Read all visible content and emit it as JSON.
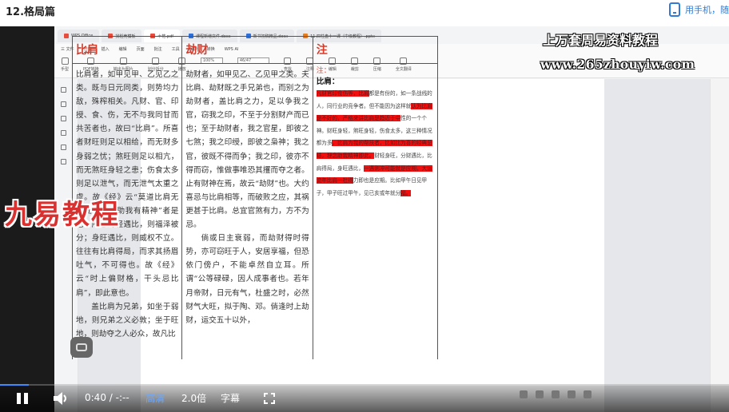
{
  "header": {
    "title": "12.格局篇",
    "phone_link": "用手机，随"
  },
  "wps": {
    "tabs": [
      {
        "label": "WPS Office",
        "color": "#e74c3c"
      },
      {
        "label": "找稻壳模板",
        "color": "#e74c3c"
      },
      {
        "label": "十格.pdf",
        "color": "#e74c3c"
      },
      {
        "label": "课程新增文件.docx",
        "color": "#2f6fd6"
      },
      {
        "label": "新书初稿精品.docx",
        "color": "#2f6fd6"
      },
      {
        "label": "11.四柱盘十一课（中级教程）.pptx",
        "color": "#e67e22"
      }
    ],
    "menu": [
      "三 文件",
      "开始",
      "插入",
      "编辑",
      "页面",
      "批注",
      "工具",
      "保护",
      "转换",
      "WPS AI"
    ],
    "menu_active": "开始",
    "toolbar": [
      "手型",
      "选择",
      "PDF转换",
      "输出为图片",
      "划分拆分",
      "播放",
      "100%",
      "旋转文件",
      "单页",
      "双页",
      "连续阅读",
      "查找",
      "注释",
      "编辑",
      "裁剪",
      "压缩",
      "全文翻译"
    ],
    "zoom": "100%",
    "page_indicator": "46/47"
  },
  "document": {
    "columns": [
      {
        "heading": "比肩",
        "paragraphs": [
          "比肩者，如甲见甲、乙见乙之类。既与日元同类，则势均力敌，殊榨相关。凡财、官、印授、食、伤，无不与我同甘而共苦者也，故曰“比肩”。所喜者财旺则足以相给，而无财多身弱之忧；煞旺则足以相亢，而无煞旺身轻之患；伤食太多则足以泄气，而无泄气太重之虞。故《经》云“莫道比肩无用处，比肩助我有精神”者是也。所忌财轻遇比，则福泽被分；身旺遇比，则威权不立。往往有比肩得局，而求其扬眉吐气，不可得也。故《经》云“时上偏财格，干头忌比肩”，即此意也。",
          "盖比肩为兄弟，如坐于弱地，则兄弟之义必敦；坐于旺地，则劫夺之人必众，故凡比"
        ]
      },
      {
        "heading": "劫财",
        "paragraphs": [
          "劫财者，如甲见乙、乙见甲之类。夫比肩、劫财既之手兄弟也，而别之为劫财者，盖比肩之力，足以争我之官，窃我之印，不至于分割财产而已也；至于劫财者，我之官星，即彼之七煞；我之印绶，即彼之枭神；我之官，彼既不得而争；我之印，彼亦不得而窃，惟做事唯恐其攫而夺之者。止有财神在焉，故云“劫财”也。大约喜忌与比肩相等，而破败之应，其祸更甚于比肩。总宜官煞有力，方不为忌。",
          "倘或日主衰弱，而劫财得时得势，亦可窃旺于人，安居享福，但恐依门傍户，不能卓然自立耳。所谓“公等碌碌，因人成事者也。若年月帝财，日元有气，杜盛之时，必然财气大旺，拟于陶、邓。倘逢时上劫财，运交五十以外，"
        ]
      },
      {
        "heading": "注",
        "note_mark": "注：",
        "note_title": "比肩：",
        "note_text": "凡财官印食伤等，比肩都是有份的，如一条战线的人，同行业的竞争者。但不能因为这样就认为比肩是不好的，严格来讲比肩是趋近于中性的一个个神。财旺身轻，煞旺身轻，伤食太多，这三种情况都为多，比肩为我的帮扶者，比如比为喜的经典总结，理念助我精神即此。财轻身旺，分财遇比，比肩得局，身旺遇比，一遇则冲可能就是应期，大运流年比肩一杜得力即也是应期。比如甲午日见甲子，甲子旺过甲午，见已亥或年就分福。"
      }
    ]
  },
  "watermarks": {
    "top_line1": "上万套周易资料教程",
    "top_line2": "www.265zhouyiw.com",
    "left": "九易教程"
  },
  "player": {
    "time": "0:40 / -:--",
    "quality": "高清",
    "speed": "2.0倍",
    "subtitle": "字幕",
    "progress": 0.04
  }
}
